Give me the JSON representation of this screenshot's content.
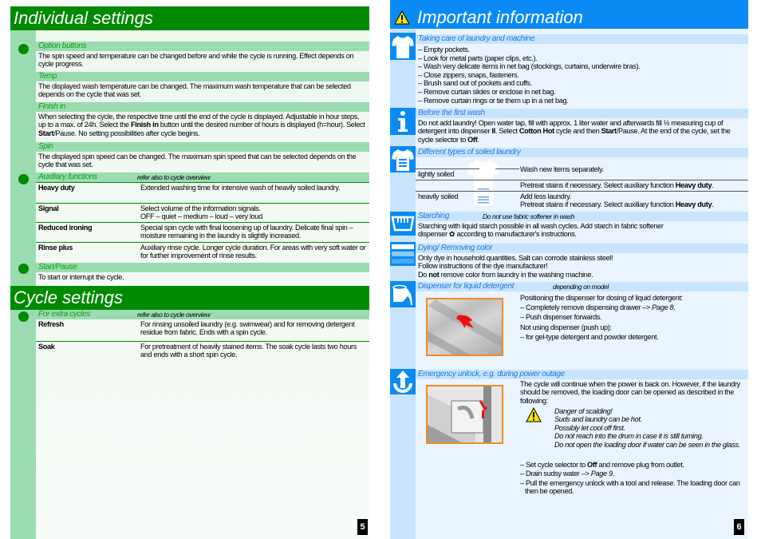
{
  "left_page": {
    "individual_title": "Individual settings",
    "option_buttons": {
      "heading": "Option buttons",
      "text": "The spin speed and temperature can be changed before and while the cycle is running. Effect depends on cycle progress."
    },
    "temp": {
      "heading": "Temp",
      "text": "The displayed wash temperature can be changed. The maximum wash temperature that can be selected depends on the cycle that was set."
    },
    "finish_in": {
      "heading": "Finish in",
      "text_1": "When selecting the cycle, the respective time until the end of the cycle is displayed. Adjustable in hour steps, up to a max. of 24h. Select the ",
      "bold_1": "Finish in",
      "text_2": " button until the desired number of hours is displayed (h=hour). Select ",
      "bold_2": "Start",
      "text_3": "/Pause. No setting possibilities after cycle begins."
    },
    "spin": {
      "heading": "Spin",
      "text": "The displayed spin speed can be changed. The maximum spin speed that can be selected depends on the cycle that was set."
    },
    "auxiliary": {
      "heading": "Auxiliary functions",
      "note": "refer also to cycle overview",
      "rows": [
        {
          "name": "Heavy duty",
          "desc": "Extended washing time for intensive wash of heavily soiled laundry."
        },
        {
          "name": "Signal",
          "desc": "Select volume of the information signals.",
          "desc2": "OFF – quiet – medium – loud – very loud"
        },
        {
          "name": "Reduced ironing",
          "desc": "Special spin cycle with final loosening up of laundry. Delicate final spin – moisture remaining in the laundry is slightly increased."
        },
        {
          "name": "Rinse plus",
          "desc": "Auxiliary rinse cycle. Longer cycle duration. For areas with very soft water or for further improvement of rinse results."
        }
      ]
    },
    "start_pause": {
      "heading": "Start/Pause",
      "text": "To start or interrupt the cycle."
    },
    "cycle_title": "Cycle settings",
    "extra_cycles": {
      "heading": "For extra cycles",
      "note": "refer also to cycle overview",
      "rows": [
        {
          "name": "Refresh",
          "desc": "For rinsing unsoiled laundry (e.g. swimwear) and for removing detergent residue from fabric. Ends with a spin cycle."
        },
        {
          "name": "Soak",
          "desc": "For pretreatment of heavily stained items. The soak cycle lasts two hours and ends with a short spin cycle."
        }
      ]
    },
    "page_number": "5"
  },
  "right_page": {
    "title": "Important information",
    "care": {
      "heading": "Taking care of laundry and machine",
      "items": [
        "– Empty pockets.",
        "– Look for metal parts (paper clips, etc.).",
        "– Wash very delicate items in net bag (stockings, curtains, underwire bras).",
        "– Close zippers, snaps, fasteners.",
        "– Brush sand out of pockets and cuffs.",
        "– Remove curtain slides or enclose in net bag.",
        "– Remove curtain rings or tie them up in a net bag."
      ]
    },
    "first_wash": {
      "heading": "Before the first wash",
      "t1": "Do not add laundry! Open water tap, fill with approx. 1 liter water and afterwards fill ½ measuring cup of detergent into dispenser ",
      "b1": "II",
      "t2": ". Select ",
      "b2": "Cotton Hot",
      "t3": " cycle and then ",
      "b3": "Start",
      "t4": "/Pause. At the end of the cycle, set the cycle selector to ",
      "b4": "Off",
      "t5": "."
    },
    "soiled": {
      "heading": "Different types of soiled laundry",
      "general": "Wash new items separately.",
      "lightly_label": "lightly soiled",
      "lightly_text_1": "Pretreat stains if necessary. Select auxiliary function ",
      "lightly_bold": "Heavy duty",
      "heavily_label": "heavily soiled",
      "heavily_line1": "Add less laundry.",
      "heavily_text_1": "Pretreat stains if necessary. Select auxiliary function ",
      "heavily_bold": "Heavy duty"
    },
    "starching": {
      "heading": "Starching",
      "note": "Do not use fabric softener in wash",
      "line1": "Starching with liquid starch possible in all wash cycles. Add starch in fabric softener",
      "line2": "dispenser ✿ according to manufacturer's instructions."
    },
    "dying": {
      "heading": "Dying/ Removing color",
      "line1": "Only dye in household quantities. Salt can corrode stainless steel!",
      "line2": "Follow instructions of the dye manufacturer!",
      "line3_a": "Do ",
      "line3_b": "not",
      "line3_c": " remove color from laundry in the washing machine."
    },
    "dispenser": {
      "heading": "Dispenser for liquid detergent",
      "note": "depending on model",
      "line1": "Positioning the dispenser for dosing of liquid detergent:",
      "line2_a": "– Completely remove dispensing drawer –> ",
      "line2_b": "Page 8",
      "line3": "– Push dispenser forwards.",
      "line4": "Not using dispenser (push up):",
      "line5": "– for gel-type detergent and powder detergent."
    },
    "emergency": {
      "heading": "Emergency unlock, e.g. during power outage",
      "intro": "The cycle will continue when the power is back on. However, if the laundry should be removed, the loading door can be opened as described in the following:",
      "warnings": [
        "Danger of scalding!",
        "Suds and laundry can be hot.",
        "Possibly let cool off first.",
        "Do not reach into the drum in case it is still turning.",
        "Do not open the loading door if water can be seen in the glass."
      ],
      "step1_a": "– Set cycle selector to ",
      "step1_b": "Off",
      "step1_c": " and remove plug from outlet.",
      "step2_a": "– Drain sudsy water –> ",
      "step2_b": "Page 9",
      "step3": "– Pull the emergency unlock with a tool and release. The loading door can then be opened."
    },
    "page_number": "6"
  }
}
